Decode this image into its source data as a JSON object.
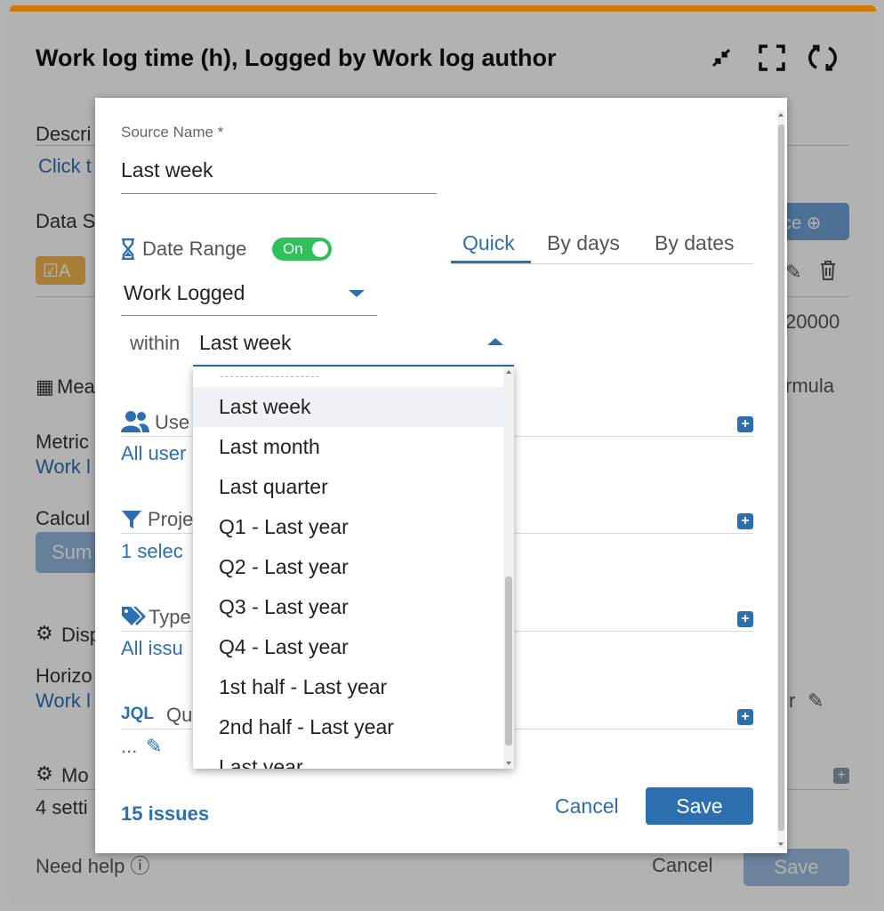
{
  "background": {
    "title": "Work log time (h), Logged by Work log author",
    "description_label": "Descri",
    "description_link": "Click t",
    "data_sources_label": "Data S",
    "source_tag": "A",
    "add_source_btn": "ce",
    "limit_value": "20000",
    "measure_label": "Mea",
    "formula_label": "rmula",
    "metric_label": "Metric",
    "metric_value": "Work l",
    "calc_label": "Calcul",
    "sum_btn": "Sum",
    "display_label": "Disp",
    "horizontal_label": "Horizo",
    "horizontal_value": "Work l",
    "horizontal_right": "r",
    "more_label": "Mo",
    "more_value": "4 setti",
    "need_help": "Need help",
    "cancel": "Cancel",
    "save": "Save"
  },
  "modal": {
    "source_name_label": "Source Name *",
    "source_name_value": "Last week",
    "date_range_label": "Date Range",
    "toggle_label": "On",
    "tabs": [
      {
        "label": "Quick",
        "active": true
      },
      {
        "label": "By days",
        "active": false
      },
      {
        "label": "By dates",
        "active": false
      }
    ],
    "date_field": "Work Logged",
    "within_label": "within",
    "within_value": "Last week",
    "filters": [
      {
        "title": "Use",
        "value": "All user"
      },
      {
        "title": "Proje",
        "value": "1 selec"
      },
      {
        "title": "Type",
        "value": "All issu"
      },
      {
        "title": "JQL",
        "title_rest": "Qu",
        "value": "..."
      }
    ],
    "issues_count": "15 issues",
    "cancel_label": "Cancel",
    "save_label": "Save"
  },
  "dropdown": {
    "separator": "--------------------",
    "options": [
      "Last week",
      "Last month",
      "Last quarter",
      "Q1 - Last year",
      "Q2 - Last year",
      "Q3 - Last year",
      "Q4 - Last year",
      "1st half - Last year",
      "2nd half - Last year",
      "Last year"
    ],
    "selected_index": 0
  },
  "colors": {
    "accent": "#2d6fae",
    "toggle_on": "#2fc05a",
    "header_bar": "#cc7a00"
  }
}
